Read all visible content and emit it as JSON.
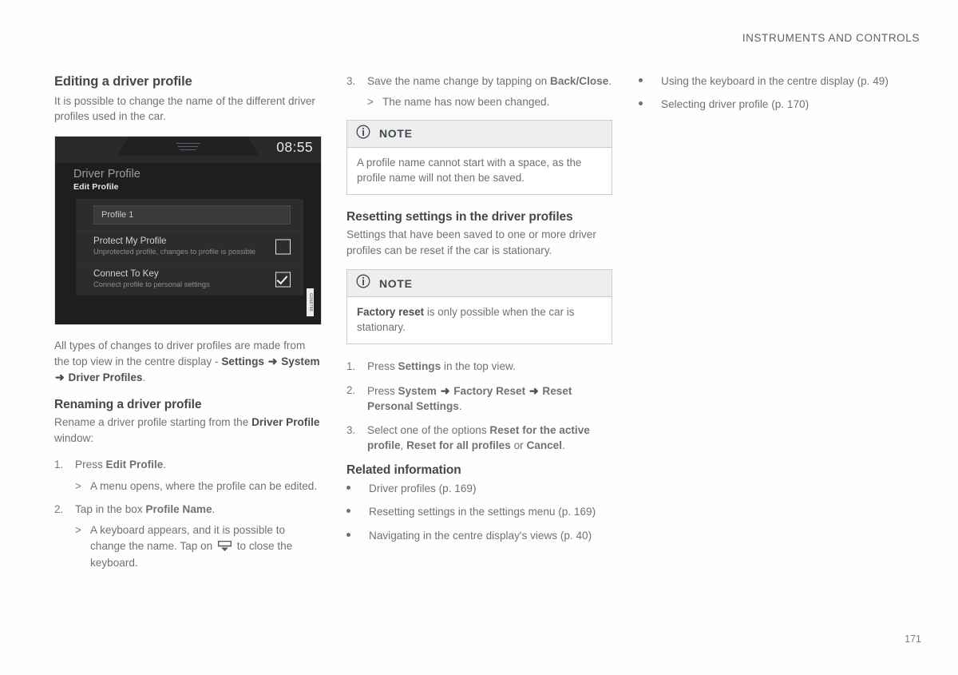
{
  "header": {
    "running_head": "INSTRUMENTS AND CONTROLS",
    "page_number": "171"
  },
  "col1": {
    "title": "Editing a driver profile",
    "intro": "It is possible to change the name of the different driver profiles used in the car.",
    "figure": {
      "clock": "08:55",
      "title": "Driver Profile",
      "subtitle": "Edit Profile",
      "profile_name_value": "Profile 1",
      "rows": [
        {
          "title": "Protect My Profile",
          "desc": "Unprotected profile, changes to profile is possible",
          "checked": false
        },
        {
          "title": "Connect To Key",
          "desc": "Connect profile to personal settings",
          "checked": true
        }
      ],
      "image_code": "G068789"
    },
    "caption_part1": "All types of changes to driver profiles are made from the top view in the centre display - ",
    "caption_b1": "Settings",
    "caption_arrow1": "➜",
    "caption_b2": "System",
    "caption_arrow2": "➜",
    "caption_b3": "Driver Profiles",
    "caption_end": ".",
    "rename_title": "Renaming a driver profile",
    "rename_intro_part1": "Rename a driver profile starting from the ",
    "rename_intro_b": "Driver Profile",
    "rename_intro_part2": " window:",
    "steps": [
      {
        "num": "1.",
        "text_part1": "Press ",
        "bold": "Edit Profile",
        "text_part2": ".",
        "result": "A menu opens, where the profile can be edited."
      },
      {
        "num": "2.",
        "text_part1": "Tap in the box ",
        "bold": "Profile Name",
        "text_part2": ".",
        "result_part1": "A keyboard appears, and it is possible to change the name. Tap on ",
        "result_part2": " to close the keyboard."
      }
    ]
  },
  "col2": {
    "step3": {
      "num": "3.",
      "text_part1": "Save the name change by tapping on ",
      "bold": "Back/Close",
      "text_part2": ".",
      "result": "The name has now been changed."
    },
    "note1": {
      "label": "NOTE",
      "body": "A profile name cannot start with a space, as the profile name will not then be saved."
    },
    "reset_title": "Resetting settings in the driver profiles",
    "reset_intro": "Settings that have been saved to one or more driver profiles can be reset if the car is stationary.",
    "note2": {
      "label": "NOTE",
      "body_bold": "Factory reset",
      "body_rest": " is only possible when the car is stationary."
    },
    "reset_steps": [
      {
        "num": "1.",
        "part1": "Press ",
        "bold1": "Settings",
        "part2": " in the top view."
      },
      {
        "num": "2.",
        "part1": "Press ",
        "bold1": "System",
        "arrow1": "➜",
        "bold2": "Factory Reset",
        "arrow2": "➜",
        "bold3": "Reset Personal Settings",
        "part2": "."
      },
      {
        "num": "3.",
        "part1": "Select one of the options ",
        "bold1": "Reset for the active profile",
        "part2": ", ",
        "bold2": "Reset for all profiles",
        "part3": " or ",
        "bold3": "Cancel",
        "part4": "."
      }
    ],
    "related_title": "Related information",
    "related_items": [
      "Driver profiles (p. 169)",
      "Resetting settings in the settings menu (p. 169)",
      "Navigating in the centre display's views (p. 40)"
    ]
  },
  "col3": {
    "related_items": [
      "Using the keyboard in the centre display (p. 49)",
      "Selecting driver profile (p. 170)"
    ]
  }
}
